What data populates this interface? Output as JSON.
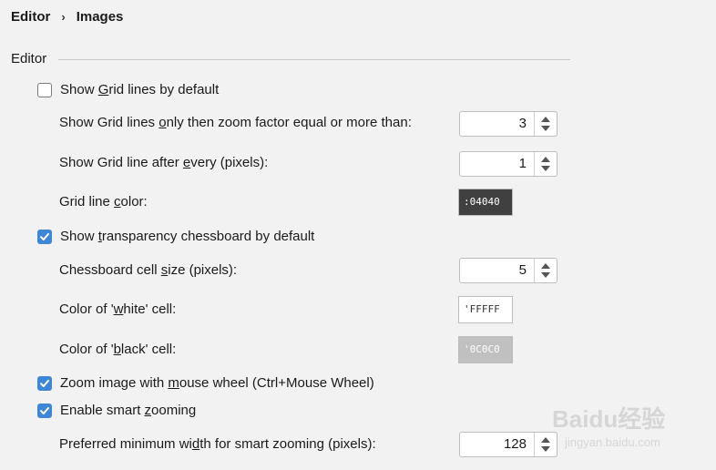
{
  "breadcrumb": {
    "parent": "Editor",
    "separator": "›",
    "current": "Images"
  },
  "group": {
    "title": "Editor"
  },
  "settings": {
    "show_grid": {
      "pre": "Show ",
      "mn": "G",
      "post": "rid lines by default",
      "checked": false
    },
    "grid_zoom": {
      "pre": "Show Grid lines ",
      "mn": "o",
      "post": "nly then zoom factor equal or more than:",
      "value": "3"
    },
    "grid_every": {
      "pre": "Show Grid line after ",
      "mn": "e",
      "post": "very (pixels):",
      "value": "1"
    },
    "grid_color": {
      "pre": "Grid line ",
      "mn": "c",
      "post": "olor:",
      "swatch_text": ":04040",
      "swatch_color": "#404040"
    },
    "show_chess": {
      "pre": "Show ",
      "mn": "t",
      "post": "ransparency chessboard by default",
      "checked": true
    },
    "chess_size": {
      "pre": "Chessboard cell ",
      "mn": "s",
      "post": "ize (pixels):",
      "value": "5"
    },
    "white_cell": {
      "pre": "Color of '",
      "mn": "w",
      "post": "hite' cell:",
      "swatch_text": "'FFFFF",
      "swatch_color": "#FFFFFF"
    },
    "black_cell": {
      "pre": "Color of '",
      "mn": "b",
      "post": "lack' cell:",
      "swatch_text": "'0C0C0",
      "swatch_color": "#C0C0C0"
    },
    "zoom_wheel": {
      "pre": "Zoom image with ",
      "mn": "m",
      "post": "ouse wheel (Ctrl+Mouse Wheel)",
      "checked": true
    },
    "smart_zoom": {
      "pre": "Enable smart ",
      "mn": "z",
      "post": "ooming",
      "checked": true
    },
    "smart_width": {
      "pre": "Preferred minimum wi",
      "mn": "d",
      "post": "th for smart zooming (pixels):",
      "value": "128"
    }
  },
  "watermark": {
    "logo": "Baidu经验",
    "url": "jingyan.baidu.com"
  },
  "colors": {
    "checkbox_accent": "#3D87D6",
    "background": "#F2F2F2"
  }
}
